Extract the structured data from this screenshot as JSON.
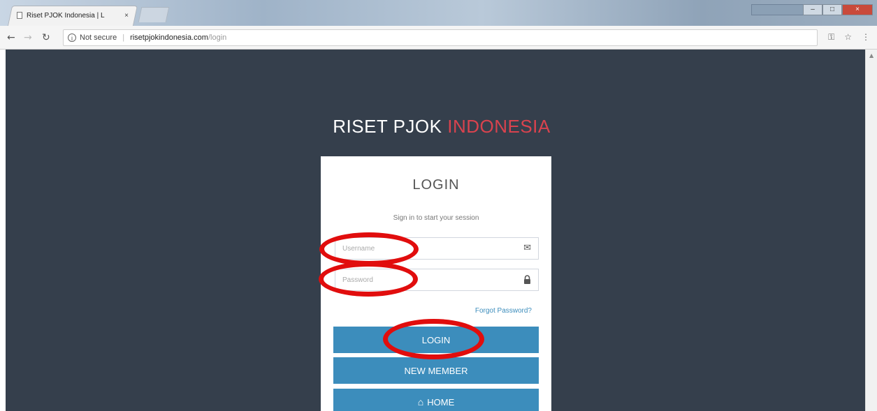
{
  "browser": {
    "tab_title": "Riset PJOK Indonesia | L",
    "tab_close": "×",
    "address": {
      "secure_label": "Not secure",
      "domain": "risetpjokindonesia.com",
      "path": "/login"
    }
  },
  "page": {
    "brand": {
      "part1": "RISET PJOK",
      "part2": "INDONESIA"
    },
    "login_box": {
      "title": "LOGIN",
      "subtitle": "Sign in to start your session",
      "username_placeholder": "Username",
      "password_placeholder": "Password",
      "forgot_link": "Forgot Password?",
      "login_button": "LOGIN",
      "new_member_button": "NEW MEMBER",
      "home_button": "HOME"
    }
  },
  "colors": {
    "background": "#353f4c",
    "brand_accent": "#d9434e",
    "button": "#3c8dbc",
    "annotation": "#e10d0d"
  },
  "icons": [
    "envelope-icon",
    "lock-icon",
    "home-icon",
    "info-icon",
    "key-icon",
    "star-icon"
  ]
}
